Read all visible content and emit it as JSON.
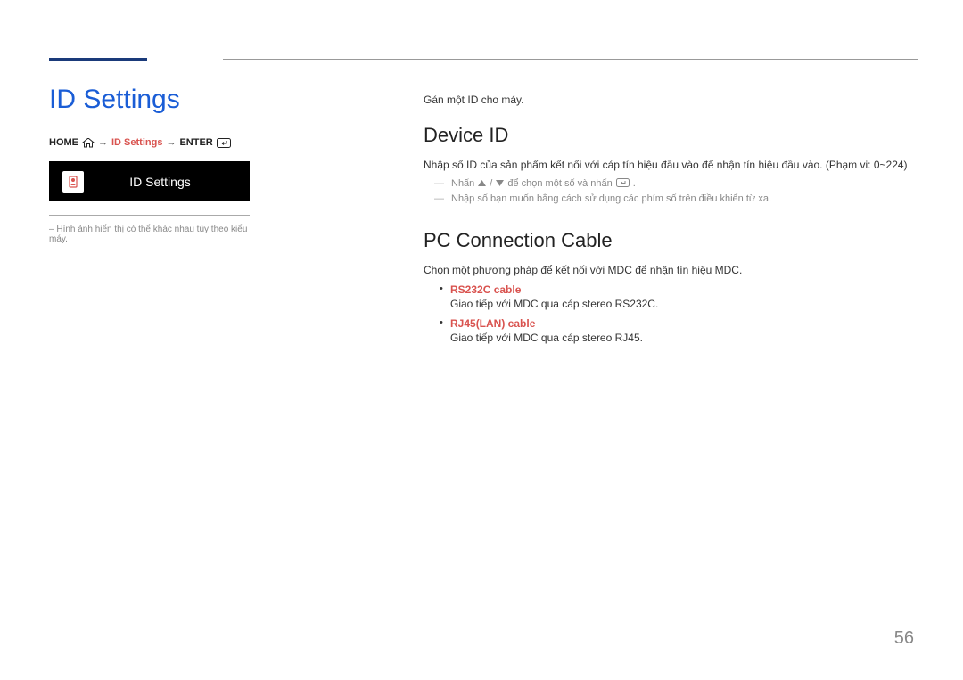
{
  "page": {
    "number": "56"
  },
  "left": {
    "title": "ID Settings",
    "breadcrumb": {
      "home": "HOME",
      "step": "ID Settings",
      "enter": "ENTER"
    },
    "settings_box_label": "ID Settings",
    "note": "Hình ảnh hiển thị có thể khác nhau tùy theo kiểu máy."
  },
  "right": {
    "intro": "Gán một ID cho máy.",
    "device_id": {
      "heading": "Device ID",
      "desc": "Nhập số ID của sản phẩm kết nối với cáp tín hiệu đầu vào để nhận tín hiệu đầu vào. (Phạm vi: 0~224)",
      "dash1_pre": "Nhấn ",
      "dash1_mid": " để chọn một số và nhấn ",
      "dash1_post": ".",
      "dash2": "Nhập số bạn muốn bằng cách sử dụng các phím số trên điều khiển từ xa."
    },
    "pc_cable": {
      "heading": "PC Connection Cable",
      "desc": "Chọn một phương pháp để kết nối với MDC để nhận tín hiệu MDC.",
      "items": [
        {
          "title": "RS232C cable",
          "desc": "Giao tiếp với MDC qua cáp stereo RS232C."
        },
        {
          "title": "RJ45(LAN) cable",
          "desc": "Giao tiếp với MDC qua cáp stereo RJ45."
        }
      ]
    }
  }
}
